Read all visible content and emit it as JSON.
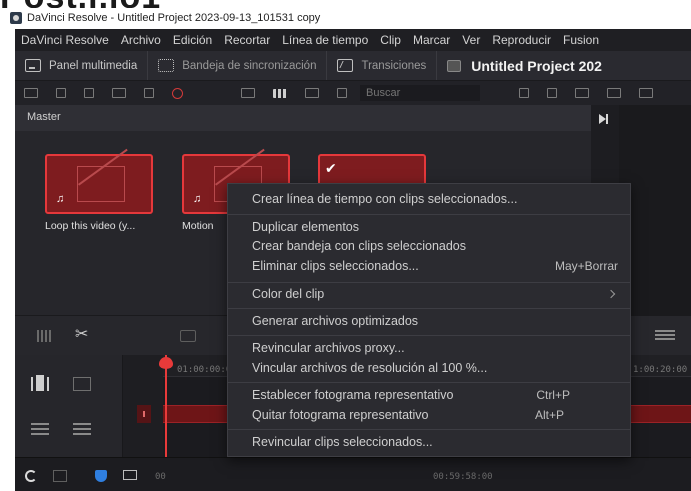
{
  "window_title": "DaVinci Resolve - Untitled Project 2023-09-13_101531 copy",
  "menu": [
    "DaVinci Resolve",
    "Archivo",
    "Edición",
    "Recortar",
    "Línea de tiempo",
    "Clip",
    "Marcar",
    "Ver",
    "Reproducir",
    "Fusion"
  ],
  "toolbar": {
    "media_pool": "Panel multimedia",
    "sync_bin": "Bandeja de sincronización",
    "transitions": "Transiciones",
    "project_name": "Untitled Project 202"
  },
  "search": {
    "placeholder": "Buscar"
  },
  "bin": {
    "name": "Master"
  },
  "clips": [
    {
      "label": "Loop this video (y..."
    },
    {
      "label": "Motion"
    },
    {
      "label": ""
    }
  ],
  "timeline": {
    "tc_start": "01:00:00:0",
    "tc_mid": "1:00:20:00",
    "tc_status": "00:59:58:00",
    "status_left": "00"
  },
  "context_menu": {
    "items": [
      {
        "label": "Crear línea de tiempo con clips seleccionados...",
        "shortcut": ""
      },
      {
        "label": "Duplicar elementos",
        "shortcut": ""
      },
      {
        "label": "Crear bandeja con clips seleccionados",
        "shortcut": ""
      },
      {
        "label": "Eliminar clips seleccionados...",
        "shortcut": "May+Borrar"
      },
      {
        "label": "Color del clip",
        "shortcut": ""
      },
      {
        "label": "Generar archivos optimizados",
        "shortcut": ""
      },
      {
        "label": "Revincular archivos proxy...",
        "shortcut": ""
      },
      {
        "label": "Vincular archivos de resolución al 100 %...",
        "shortcut": ""
      },
      {
        "label": "Establecer fotograma representativo",
        "shortcut": "Ctrl+P"
      },
      {
        "label": "Quitar fotograma representativo",
        "shortcut": "Alt+P"
      },
      {
        "label": "Revincular clips seleccionados...",
        "shortcut": ""
      }
    ]
  },
  "colors": {
    "accent": "#e5383b",
    "clip_fill": "#7e1c1f",
    "panel": "#28282e"
  }
}
